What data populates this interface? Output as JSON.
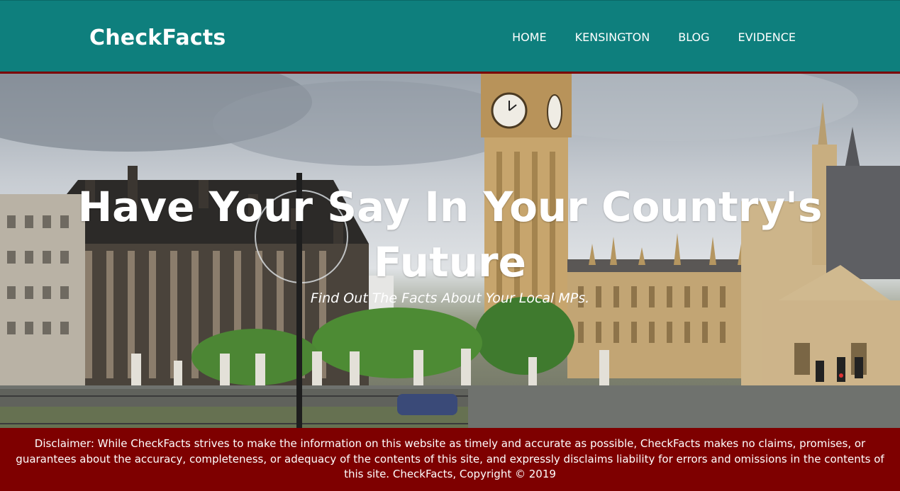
{
  "brand": {
    "name": "CheckFacts"
  },
  "nav": {
    "items": [
      {
        "label": "HOME"
      },
      {
        "label": "KENSINGTON"
      },
      {
        "label": "BLOG"
      },
      {
        "label": "EVIDENCE"
      }
    ]
  },
  "hero": {
    "title": "Have Your Say In Your Country's Future",
    "subtitle": "Find Out The Facts About Your Local MPs.",
    "image_description_icon": "westminster-photo"
  },
  "footer": {
    "disclaimer": "Disclaimer: While CheckFacts strives to make the information on this website as timely and accurate as possible, CheckFacts makes no claims, promises, or guarantees about the accuracy, completeness, or adequacy of the contents of this site, and expressly disclaims liability for errors and omissions in the contents of this site. CheckFacts, Copyright © 2019"
  },
  "colors": {
    "navbar": "#0e7f7d",
    "accent_border": "#7a0000",
    "footer": "#7e0000",
    "text": "#ffffff"
  }
}
